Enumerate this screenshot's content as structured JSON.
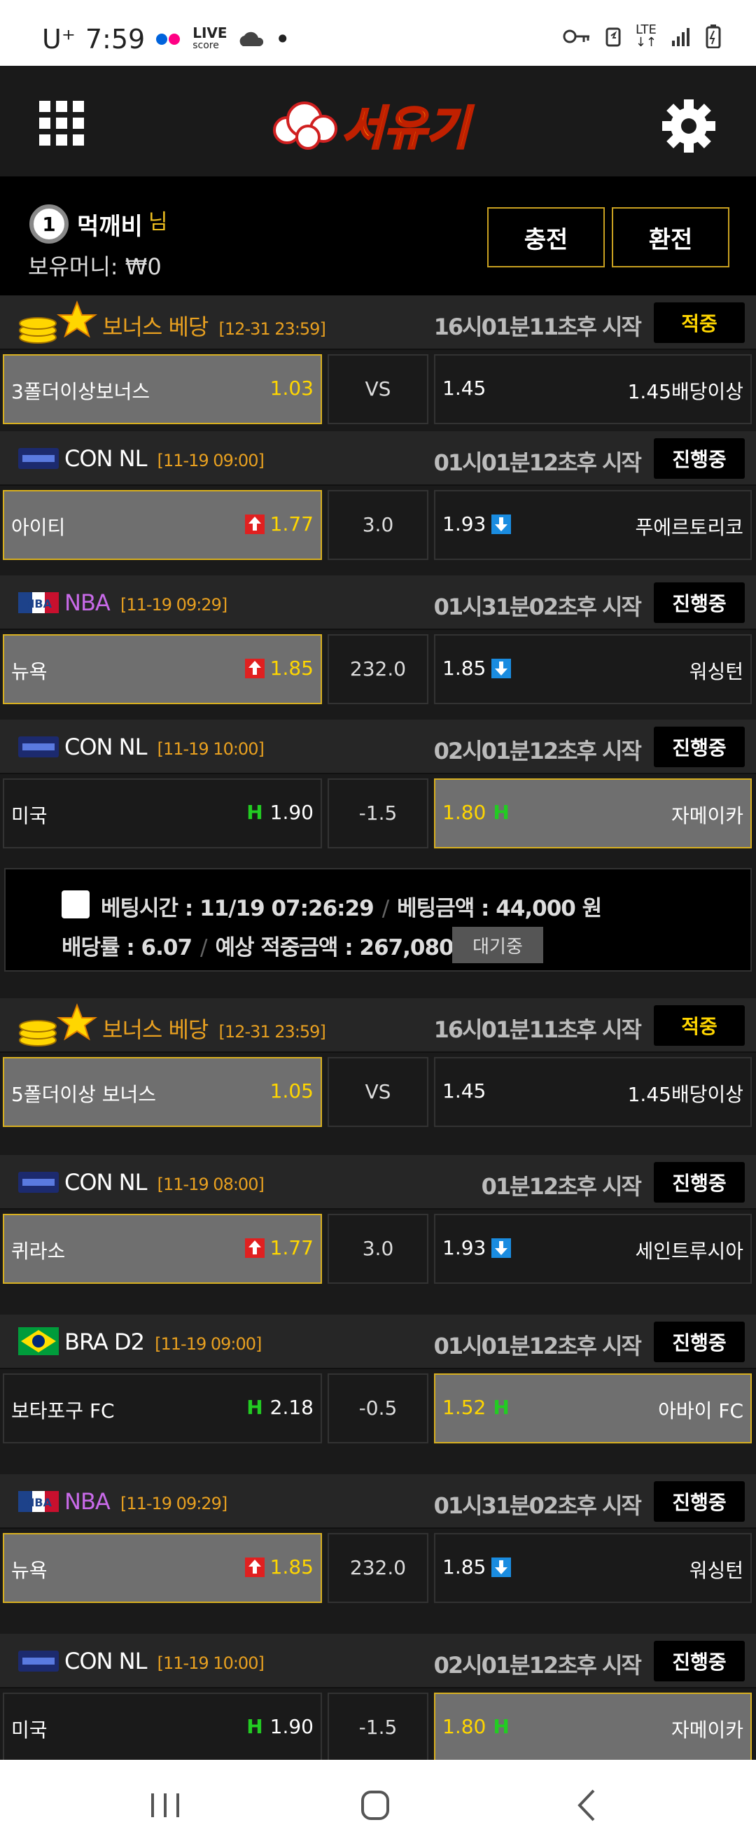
{
  "status_bar": {
    "carrier": "U⁺",
    "time": "7:59",
    "live_label": "LIVE",
    "live_sub": "score",
    "lte": "LTE"
  },
  "header": {
    "logo_text": "서유기"
  },
  "user": {
    "level": "1",
    "name": "먹깨비",
    "suffix": "님",
    "money_label": "보유머니:",
    "money_value": "₩0",
    "charge_label": "충전",
    "exchange_label": "환전"
  },
  "matches": [
    {
      "league": "보너스 베당",
      "time": "[12-31 23:59]",
      "countdown": "16시01분11초후 시작",
      "status": "적중",
      "home": "3폴더이상보너스",
      "home_odd": "1.03",
      "mid": "VS",
      "away_odd": "1.45",
      "away": "1.45배당이상"
    },
    {
      "league": "CON NL",
      "time": "[11-19 09:00]",
      "countdown": "01시01분12초후 시작",
      "status": "진행중",
      "home": "아이티",
      "home_odd": "1.77",
      "mid": "3.0",
      "away_odd": "1.93",
      "away": "푸에르토리코"
    },
    {
      "league": "NBA",
      "time": "[11-19 09:29]",
      "countdown": "01시31분02초후 시작",
      "status": "진행중",
      "home": "뉴욕",
      "home_odd": "1.85",
      "mid": "232.0",
      "away_odd": "1.85",
      "away": "워싱턴"
    },
    {
      "league": "CON NL",
      "time": "[11-19 10:00]",
      "countdown": "02시01분12초후 시작",
      "status": "진행중",
      "home": "미국",
      "home_odd": "1.90",
      "mid": "-1.5",
      "away_odd": "1.80",
      "away": "자메이카"
    },
    {
      "league": "보너스 베당",
      "time": "[12-31 23:59]",
      "countdown": "16시01분11초후 시작",
      "status": "적중",
      "home": "5폴더이상 보너스",
      "home_odd": "1.05",
      "mid": "VS",
      "away_odd": "1.45",
      "away": "1.45배당이상"
    },
    {
      "league": "CON NL",
      "time": "[11-19 08:00]",
      "countdown": "01분12초후 시작",
      "status": "진행중",
      "home": "퀴라소",
      "home_odd": "1.77",
      "mid": "3.0",
      "away_odd": "1.93",
      "away": "세인트루시아"
    },
    {
      "league": "BRA D2",
      "time": "[11-19 09:00]",
      "countdown": "01시01분12초후 시작",
      "status": "진행중",
      "home": "보타포구 FC",
      "home_odd": "2.18",
      "mid": "-0.5",
      "away_odd": "1.52",
      "away": "아바이 FC"
    },
    {
      "league": "NBA",
      "time": "[11-19 09:29]",
      "countdown": "01시31분02초후 시작",
      "status": "진행중",
      "home": "뉴욕",
      "home_odd": "1.85",
      "mid": "232.0",
      "away_odd": "1.85",
      "away": "워싱턴"
    },
    {
      "league": "CON NL",
      "time": "[11-19 10:00]",
      "countdown": "02시01분12초후 시작",
      "status": "진행중",
      "home": "미국",
      "home_odd": "1.90",
      "mid": "-1.5",
      "away_odd": "1.80",
      "away": "자메이카"
    }
  ],
  "slip": {
    "bet_time_label": "베팅시간 :",
    "bet_time": "11/19 07:26:29",
    "bet_amount_label": "베팅금액 :",
    "bet_amount": "44,000 원",
    "rate_label": "배당률 :",
    "rate": "6.07",
    "expected_label": "예상 적중금액 :",
    "expected": "267,080 원",
    "wait_label": "대기중"
  },
  "colors": {
    "accent": "#e8a020",
    "gold": "#ffd600",
    "selected_bg": "#6f6f6f",
    "up": "#e02020",
    "down": "#1a8ce0",
    "handicap": "#22cc22"
  }
}
